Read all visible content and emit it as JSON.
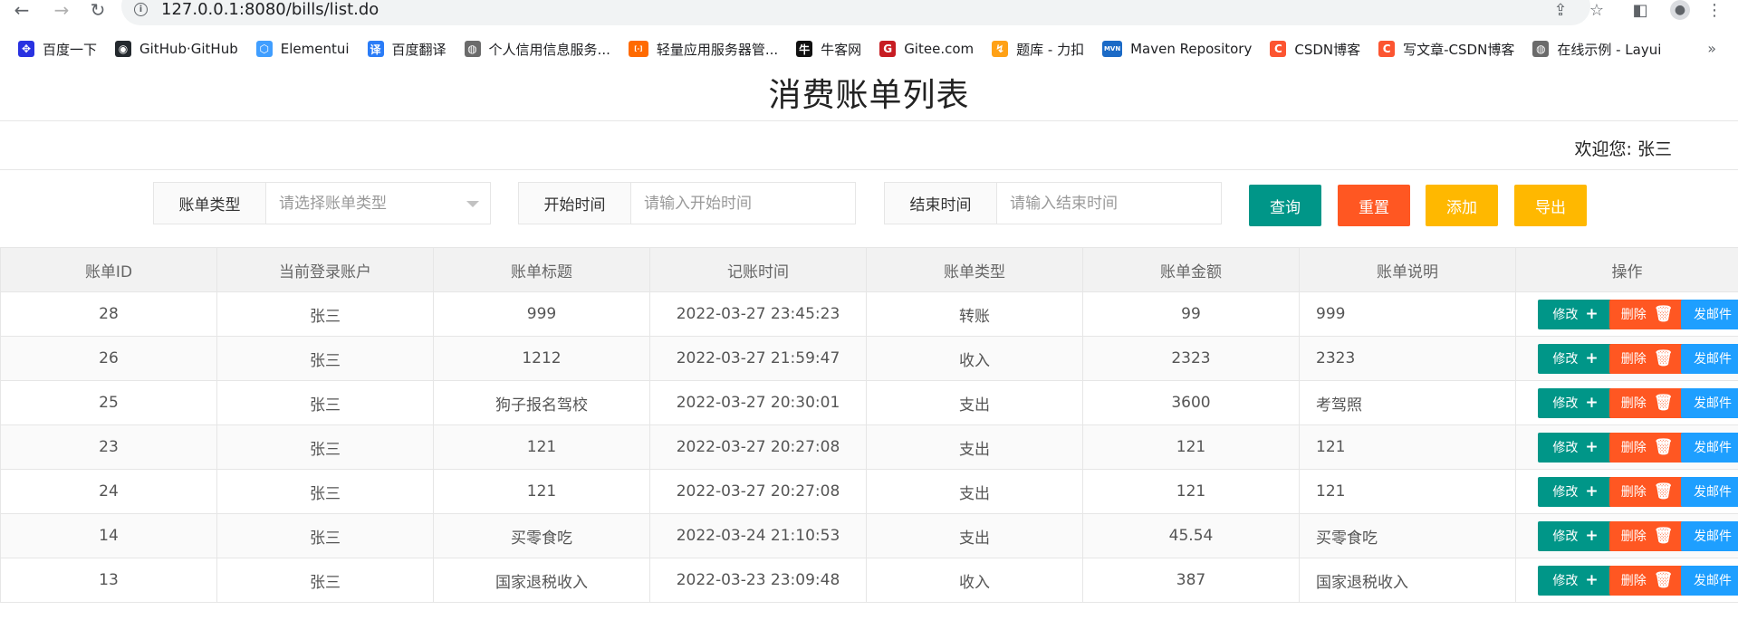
{
  "browser": {
    "url": "127.0.0.1:8080/bills/list.do",
    "bookmarks": [
      {
        "label": "百度一下",
        "color": "#2932e1",
        "glyph": "✥"
      },
      {
        "label": "GitHub·GitHub",
        "color": "#24292e",
        "glyph": "◉"
      },
      {
        "label": "Elementui",
        "color": "#409eff",
        "glyph": "⬡"
      },
      {
        "label": "百度翻译",
        "color": "#2a7cf7",
        "glyph": "译"
      },
      {
        "label": "个人信用信息服务...",
        "color": "#6b6b6b",
        "glyph": "◍"
      },
      {
        "label": "轻量应用服务器管...",
        "color": "#ff6a00",
        "glyph": "[-]"
      },
      {
        "label": "牛客网",
        "color": "#111111",
        "glyph": "牛"
      },
      {
        "label": "Gitee.com",
        "color": "#c71d23",
        "glyph": "G"
      },
      {
        "label": "题库 - 力扣",
        "color": "#ffa116",
        "glyph": "↯"
      },
      {
        "label": "Maven Repository",
        "color": "#1b6ac6",
        "glyph": "MVN"
      },
      {
        "label": "CSDN博客",
        "color": "#fc5531",
        "glyph": "C"
      },
      {
        "label": "写文章-CSDN博客",
        "color": "#fc5531",
        "glyph": "C"
      },
      {
        "label": "在线示例 - Layui",
        "color": "#6b6b6b",
        "glyph": "◍"
      }
    ],
    "more": "»"
  },
  "page": {
    "title": "消费账单列表",
    "welcome": "欢迎您: 张三"
  },
  "filters": {
    "type_label": "账单类型",
    "type_placeholder": "请选择账单类型",
    "start_label": "开始时间",
    "start_placeholder": "请输入开始时间",
    "end_label": "结束时间",
    "end_placeholder": "请输入结束时间"
  },
  "buttons": {
    "search": "查询",
    "reset": "重置",
    "add": "添加",
    "export": "导出"
  },
  "colors": {
    "primary": "#009688",
    "danger": "#ff5722",
    "warm": "#ffb800",
    "normal": "#1e9fff"
  },
  "table": {
    "headers": [
      "账单ID",
      "当前登录账户",
      "账单标题",
      "记账时间",
      "账单类型",
      "账单金额",
      "账单说明",
      "操作"
    ],
    "ops": {
      "edit": "修改",
      "delete": "删除",
      "mail": "发邮件"
    },
    "rows": [
      {
        "id": "28",
        "user": "张三",
        "title": "999",
        "time": "2022-03-27 23:45:23",
        "type": "转账",
        "amount": "99",
        "desc": "999"
      },
      {
        "id": "26",
        "user": "张三",
        "title": "1212",
        "time": "2022-03-27 21:59:47",
        "type": "收入",
        "amount": "2323",
        "desc": "2323"
      },
      {
        "id": "25",
        "user": "张三",
        "title": "狗子报名驾校",
        "time": "2022-03-27 20:30:01",
        "type": "支出",
        "amount": "3600",
        "desc": "考驾照"
      },
      {
        "id": "23",
        "user": "张三",
        "title": "121",
        "time": "2022-03-27 20:27:08",
        "type": "支出",
        "amount": "121",
        "desc": "121"
      },
      {
        "id": "24",
        "user": "张三",
        "title": "121",
        "time": "2022-03-27 20:27:08",
        "type": "支出",
        "amount": "121",
        "desc": "121"
      },
      {
        "id": "14",
        "user": "张三",
        "title": "买零食吃",
        "time": "2022-03-24 21:10:53",
        "type": "支出",
        "amount": "45.54",
        "desc": "买零食吃"
      },
      {
        "id": "13",
        "user": "张三",
        "title": "国家退税收入",
        "time": "2022-03-23 23:09:48",
        "type": "收入",
        "amount": "387",
        "desc": "国家退税收入"
      }
    ]
  }
}
